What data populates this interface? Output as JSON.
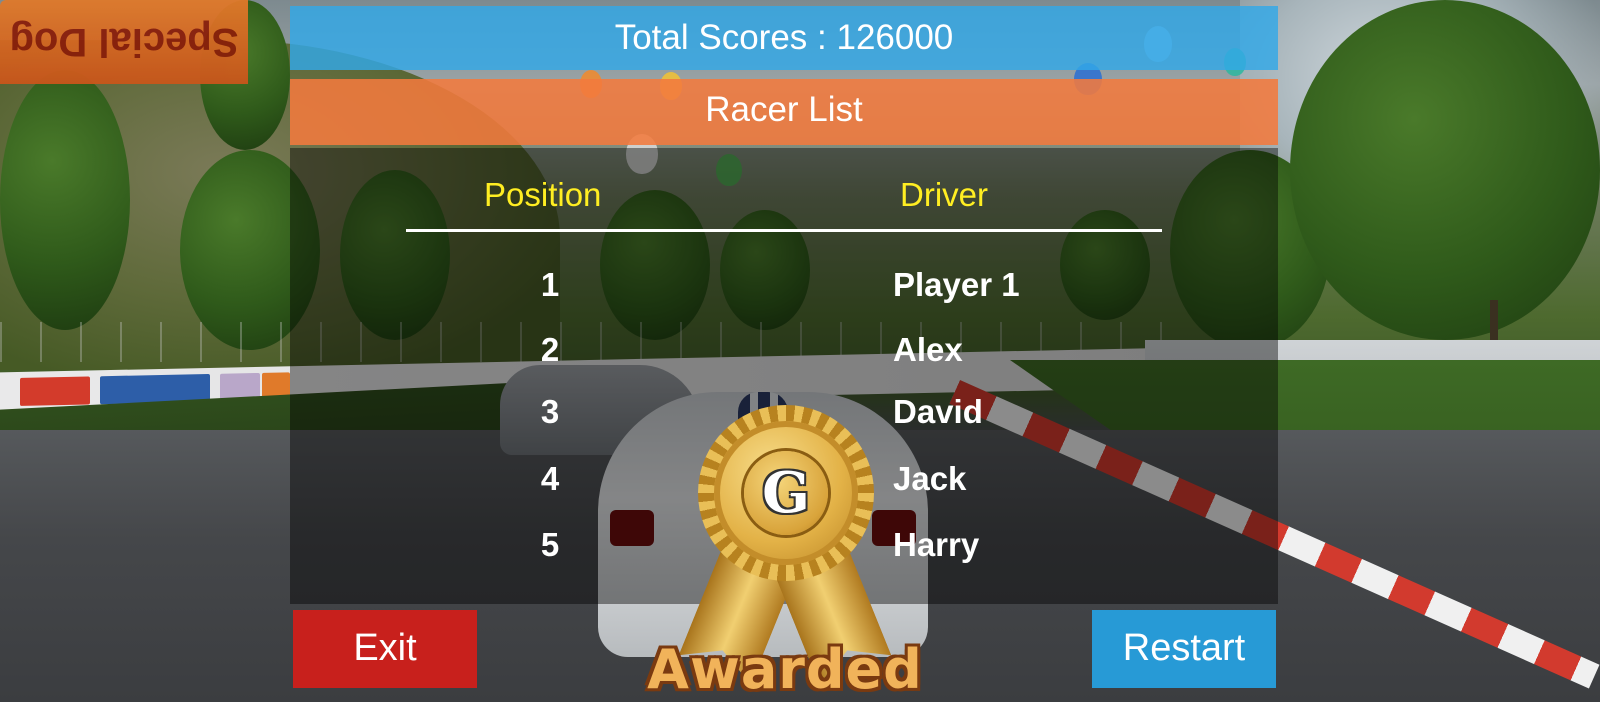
{
  "score_bar": {
    "text": "Total Scores : 126000"
  },
  "list_bar": {
    "title": "Racer List"
  },
  "table": {
    "headers": {
      "position": "Position",
      "driver": "Driver"
    },
    "rows": [
      {
        "position": "1",
        "driver": "Player 1"
      },
      {
        "position": "2",
        "driver": "Alex"
      },
      {
        "position": "3",
        "driver": "David"
      },
      {
        "position": "4",
        "driver": "Jack"
      },
      {
        "position": "5",
        "driver": "Harry"
      }
    ]
  },
  "buttons": {
    "exit": "Exit",
    "restart": "Restart"
  },
  "medal": {
    "letter": "G",
    "caption": "Awarded"
  },
  "scene": {
    "billboard": "Special Dog"
  },
  "colors": {
    "score_bar": "#32a8e8",
    "list_bar": "#f27a3e",
    "header_text": "#ffee22",
    "exit_button": "#c8201c",
    "restart_button": "#279ad6",
    "medal_gold": "#e3b247"
  }
}
